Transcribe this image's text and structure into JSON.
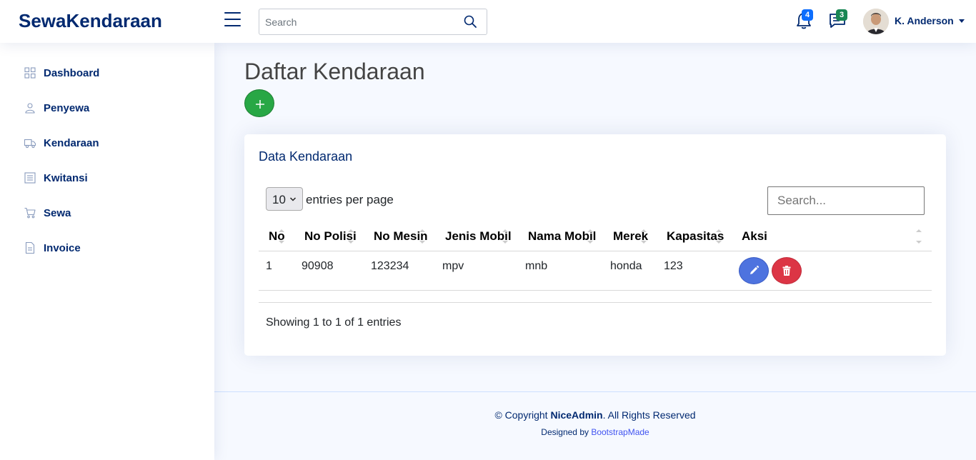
{
  "header": {
    "logo": "SewaKendaraan",
    "search_placeholder": "Search",
    "notifications_count": "4",
    "messages_count": "3",
    "profile_name": "K. Anderson"
  },
  "sidebar": {
    "items": [
      {
        "label": "Dashboard",
        "icon": "grid-icon"
      },
      {
        "label": "Penyewa",
        "icon": "person-icon"
      },
      {
        "label": "Kendaraan",
        "icon": "truck-icon"
      },
      {
        "label": "Kwitansi",
        "icon": "receipt-icon"
      },
      {
        "label": "Sewa",
        "icon": "cart-icon"
      },
      {
        "label": "Invoice",
        "icon": "file-icon"
      }
    ]
  },
  "main": {
    "page_title": "Daftar Kendaraan",
    "card_title": "Data Kendaraan",
    "per_page_value": "10",
    "per_page_label": "entries per page",
    "table_search_placeholder": "Search...",
    "columns": [
      "No",
      "No Polisi",
      "No Mesin",
      "Jenis Mobil",
      "Nama Mobil",
      "Merek",
      "Kapasitas",
      "Aksi"
    ],
    "rows": [
      {
        "no": "1",
        "no_polisi": "90908",
        "no_mesin": "123234",
        "jenis_mobil": "mpv",
        "nama_mobil": "mnb",
        "merek": "honda",
        "kapasitas": "123"
      }
    ],
    "showing": "Showing 1 to 1 of 1 entries"
  },
  "footer": {
    "copyright_prefix": "© Copyright ",
    "brand": "NiceAdmin",
    "copyright_suffix": ". All Rights Reserved",
    "designed_by": "Designed by ",
    "designer": "BootstrapMade"
  },
  "colors": {
    "primary": "#012970",
    "add_button": "#28a745",
    "edit_button": "#4e73df",
    "delete_button": "#dc3545",
    "badge_blue": "#0d6efd",
    "badge_green": "#198754"
  }
}
